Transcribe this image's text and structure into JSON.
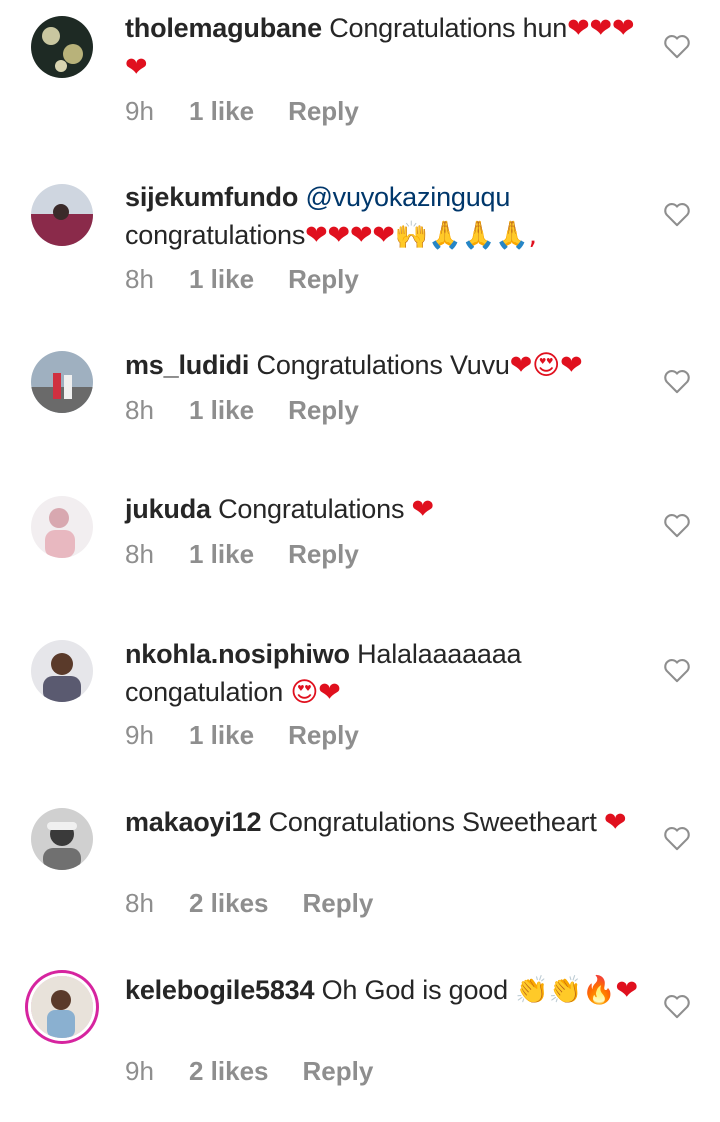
{
  "comments": [
    {
      "username": "tholemagubane",
      "mention": "",
      "text": "Congratulations hun",
      "emoji": "❤❤❤❤",
      "time": "9h",
      "likes": "1 like",
      "reply": "Reply",
      "avatar_color": "#2d3a2a"
    },
    {
      "username": "sijekumfundo",
      "mention": "@vuyokazinguqu",
      "text": "congratulations",
      "emoji": "❤❤❤❤🙌🙏🙏🙏,",
      "time": "8h",
      "likes": "1 like",
      "reply": "Reply",
      "avatar_color": "#8a2a4a"
    },
    {
      "username": "ms_ludidi",
      "mention": "",
      "text": "Congratulations Vuvu",
      "emoji": "❤😍❤",
      "time": "8h",
      "likes": "1 like",
      "reply": "Reply",
      "avatar_color": "#7a8a99"
    },
    {
      "username": "jukuda",
      "mention": "",
      "text": "Congratulations ",
      "emoji": "❤",
      "time": "8h",
      "likes": "1 like",
      "reply": "Reply",
      "avatar_color": "#e8c8cc"
    },
    {
      "username": "nkohla.nosiphiwo",
      "mention": "",
      "text": "Halalaaaaaaa congatulation ",
      "emoji": "😍❤",
      "time": "9h",
      "likes": "1 like",
      "reply": "Reply",
      "avatar_color": "#5a4a44"
    },
    {
      "username": "makaoyi12",
      "mention": "",
      "text": "Congratulations Sweetheart ",
      "emoji": "❤",
      "time": "8h",
      "likes": "2 likes",
      "reply": "Reply",
      "avatar_color": "#9a9a9a"
    },
    {
      "username": "kelebogile5834",
      "mention": "",
      "text": "Oh God is good ",
      "emoji": "👏👏🔥❤",
      "time": "9h",
      "likes": "2 likes",
      "reply": "Reply",
      "avatar_color": "#c8b8a8"
    }
  ]
}
